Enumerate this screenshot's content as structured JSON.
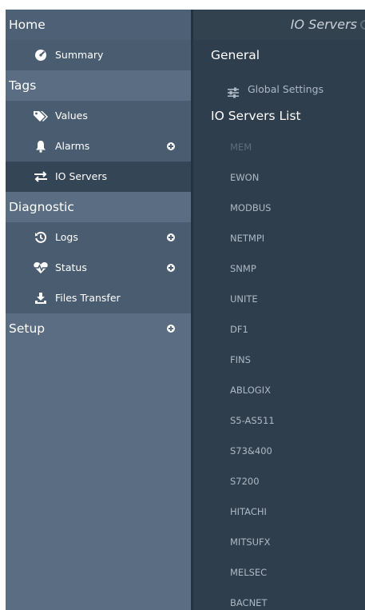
{
  "sidebar": {
    "home": "Home",
    "summary": "Summary",
    "tags": "Tags",
    "values": "Values",
    "alarms": "Alarms",
    "io_servers": "IO Servers",
    "diagnostic": "Diagnostic",
    "logs": "Logs",
    "status": "Status",
    "files_transfer": "Files Transfer",
    "setup": "Setup"
  },
  "main": {
    "title": "IO Servers",
    "general": "General",
    "global_settings": "Global Settings",
    "list_title": "IO Servers List",
    "servers": [
      "MEM",
      "EWON",
      "MODBUS",
      "NETMPI",
      "SNMP",
      "UNITE",
      "DF1",
      "FINS",
      "ABLOGIX",
      "S5-AS511",
      "S73&400",
      "S7200",
      "HITACHI",
      "MITSUFX",
      "MELSEC",
      "BACNET"
    ]
  }
}
